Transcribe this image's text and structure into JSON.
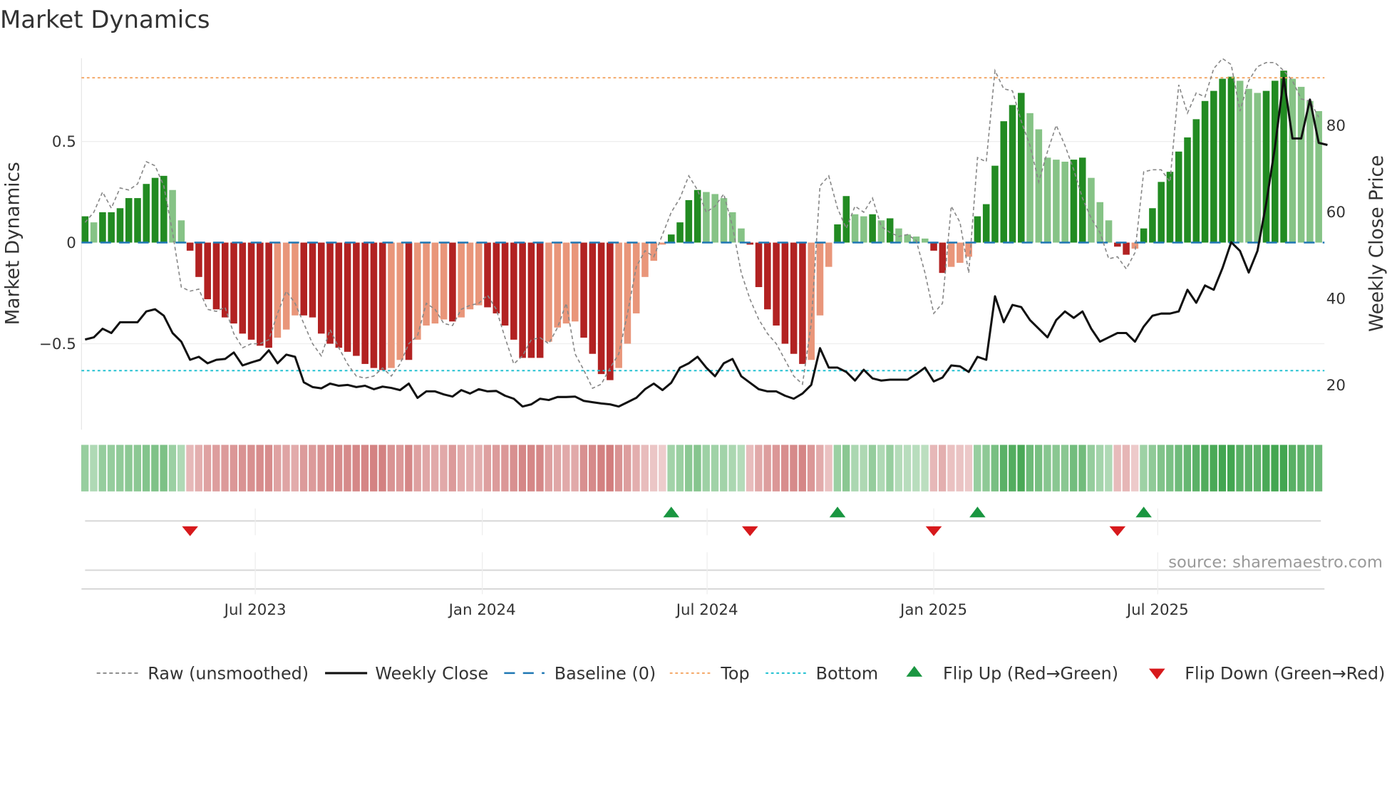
{
  "chart_data": {
    "type": "bar",
    "title": "Market Dynamics",
    "ylabel": "Market Dynamics",
    "y2label": "Weekly Close Price",
    "ylim": [
      -0.92,
      0.92
    ],
    "y2lim": [
      15.5,
      91.5
    ],
    "y_ticks": [
      {
        "label": "0.5",
        "value": 0.5
      },
      {
        "label": "0",
        "value": 0
      },
      {
        "label": "−0.5",
        "value": -0.5
      }
    ],
    "y2_ticks": [
      {
        "label": "80",
        "value": 80
      },
      {
        "label": "60",
        "value": 60
      },
      {
        "label": "40",
        "value": 40
      },
      {
        "label": "20",
        "value": 20
      }
    ],
    "x_ticks": [
      {
        "label": "Jul 2023",
        "week": 19.45
      },
      {
        "label": "Jan 2024",
        "week": 45.4
      },
      {
        "label": "Jul 2024",
        "week": 71.1
      },
      {
        "label": "Jan 2025",
        "week": 97.0
      },
      {
        "label": "Jul 2025",
        "week": 122.6
      }
    ],
    "top_level": 0.815,
    "bottom_level": -0.633,
    "baseline": 0,
    "smoothed": [
      0.13,
      0.1,
      0.15,
      0.15,
      0.17,
      0.22,
      0.22,
      0.29,
      0.32,
      0.33,
      0.26,
      0.11,
      -0.04,
      -0.17,
      -0.28,
      -0.33,
      -0.37,
      -0.4,
      -0.45,
      -0.48,
      -0.51,
      -0.52,
      -0.47,
      -0.43,
      -0.36,
      -0.36,
      -0.37,
      -0.45,
      -0.5,
      -0.52,
      -0.54,
      -0.56,
      -0.6,
      -0.62,
      -0.63,
      -0.62,
      -0.58,
      -0.58,
      -0.48,
      -0.41,
      -0.4,
      -0.38,
      -0.39,
      -0.37,
      -0.33,
      -0.31,
      -0.32,
      -0.35,
      -0.41,
      -0.48,
      -0.57,
      -0.57,
      -0.57,
      -0.49,
      -0.42,
      -0.4,
      -0.39,
      -0.47,
      -0.55,
      -0.65,
      -0.68,
      -0.62,
      -0.5,
      -0.35,
      -0.17,
      -0.09,
      -0.01,
      0.04,
      0.1,
      0.21,
      0.26,
      0.25,
      0.24,
      0.22,
      0.15,
      0.07,
      -0.01,
      -0.22,
      -0.33,
      -0.41,
      -0.5,
      -0.55,
      -0.6,
      -0.58,
      -0.36,
      -0.12,
      0.09,
      0.23,
      0.14,
      0.13,
      0.14,
      0.11,
      0.12,
      0.07,
      0.04,
      0.03,
      0.02,
      -0.04,
      -0.15,
      -0.12,
      -0.1,
      -0.07,
      0.13,
      0.19,
      0.38,
      0.6,
      0.68,
      0.74,
      0.64,
      0.56,
      0.42,
      0.41,
      0.4,
      0.41,
      0.42,
      0.32,
      0.2,
      0.11,
      -0.02,
      -0.06,
      -0.03,
      0.07,
      0.17,
      0.3,
      0.35,
      0.45,
      0.52,
      0.61,
      0.7,
      0.75,
      0.81,
      0.82,
      0.8,
      0.76,
      0.74,
      0.75,
      0.8,
      0.85,
      0.81,
      0.77,
      0.7,
      0.65
    ],
    "raw": [
      0.1,
      0.15,
      0.25,
      0.17,
      0.27,
      0.26,
      0.29,
      0.4,
      0.38,
      0.28,
      0.05,
      -0.22,
      -0.24,
      -0.23,
      -0.33,
      -0.34,
      -0.32,
      -0.45,
      -0.52,
      -0.5,
      -0.5,
      -0.48,
      -0.35,
      -0.24,
      -0.3,
      -0.4,
      -0.5,
      -0.56,
      -0.43,
      -0.52,
      -0.6,
      -0.66,
      -0.67,
      -0.66,
      -0.62,
      -0.66,
      -0.6,
      -0.5,
      -0.46,
      -0.3,
      -0.33,
      -0.4,
      -0.41,
      -0.33,
      -0.31,
      -0.3,
      -0.26,
      -0.33,
      -0.47,
      -0.6,
      -0.56,
      -0.48,
      -0.47,
      -0.5,
      -0.42,
      -0.3,
      -0.55,
      -0.63,
      -0.72,
      -0.7,
      -0.62,
      -0.55,
      -0.35,
      -0.12,
      -0.04,
      -0.07,
      0.04,
      0.15,
      0.22,
      0.33,
      0.26,
      0.15,
      0.18,
      0.24,
      0.08,
      -0.15,
      -0.28,
      -0.38,
      -0.45,
      -0.5,
      -0.58,
      -0.66,
      -0.7,
      -0.4,
      0.28,
      0.33,
      0.17,
      0.07,
      0.18,
      0.15,
      0.22,
      0.08,
      0.05,
      0.03,
      0.04,
      0.01,
      -0.15,
      -0.35,
      -0.3,
      0.18,
      0.1,
      -0.15,
      0.42,
      0.4,
      0.85,
      0.76,
      0.75,
      0.6,
      0.48,
      0.3,
      0.45,
      0.58,
      0.48,
      0.36,
      0.22,
      0.12,
      0.05,
      -0.08,
      -0.07,
      -0.13,
      -0.05,
      0.35,
      0.36,
      0.36,
      0.3,
      0.78,
      0.64,
      0.74,
      0.72,
      0.86,
      0.91,
      0.88,
      0.65,
      0.8,
      0.87,
      0.89,
      0.89,
      0.85,
      0.8,
      0.71,
      0.7,
      0.62
    ],
    "close": [
      30.5,
      31,
      33,
      32,
      34.5,
      34.5,
      34.5,
      37,
      37.5,
      36,
      32,
      30,
      25.8,
      26.5,
      25,
      25.8,
      26,
      27.5,
      24.5,
      25.2,
      25.8,
      28,
      25,
      27,
      26.5,
      20.6,
      19.5,
      19.2,
      20.3,
      19.8,
      20,
      19.5,
      19.8,
      19,
      19.6,
      19.3,
      18.8,
      20.3,
      17,
      18.5,
      18.5,
      17.8,
      17.3,
      18.8,
      18,
      19,
      18.5,
      18.6,
      17.5,
      16.8,
      15,
      15.5,
      16.8,
      16.5,
      17.2,
      17.2,
      17.3,
      16.3,
      16,
      15.7,
      15.5,
      15,
      16,
      17,
      19,
      20.3,
      18.8,
      20.5,
      24,
      25,
      26.5,
      24,
      22,
      25,
      26,
      22,
      20.5,
      19,
      18.5,
      18.5,
      17.5,
      16.8,
      18,
      20,
      28.5,
      24,
      24,
      23,
      21,
      23.5,
      21.5,
      21,
      21.2,
      21.2,
      21.2,
      22.5,
      24,
      20.8,
      21.7,
      24.5,
      24.3,
      23,
      26.5,
      25.8,
      40.5,
      34.5,
      38.5,
      38,
      35,
      33,
      31,
      35,
      37,
      35.5,
      37,
      33,
      30,
      31,
      32,
      32,
      30,
      33.5,
      36,
      36.5,
      36.5,
      37,
      42,
      39,
      43,
      42,
      47,
      53,
      51,
      46,
      51,
      62,
      75,
      91,
      77,
      77,
      86,
      76,
      75.5
    ],
    "flip_up_weeks": [
      67,
      86,
      102,
      121
    ],
    "flip_down_weeks": [
      12,
      76,
      97,
      118
    ],
    "legend": {
      "placement": "bottom",
      "raw": "Raw (unsmoothed)",
      "close": "Weekly Close",
      "baseline": "Baseline (0)",
      "top": "Top",
      "bottom": "Bottom",
      "flip_up": "Flip Up (Red→Green)",
      "flip_down": "Flip Down (Green→Red)"
    },
    "source": "source: sharemaestro.com"
  },
  "colors": {
    "green_strong": "#228b22",
    "green_weak": "#86c386",
    "red_strong": "#b22222",
    "red_weak": "#e9967a",
    "baseline": "#1f77b4",
    "top": "#f4a460",
    "bottom": "#17becf",
    "flip_up": "#1a9641",
    "flip_down": "#d7191c"
  }
}
